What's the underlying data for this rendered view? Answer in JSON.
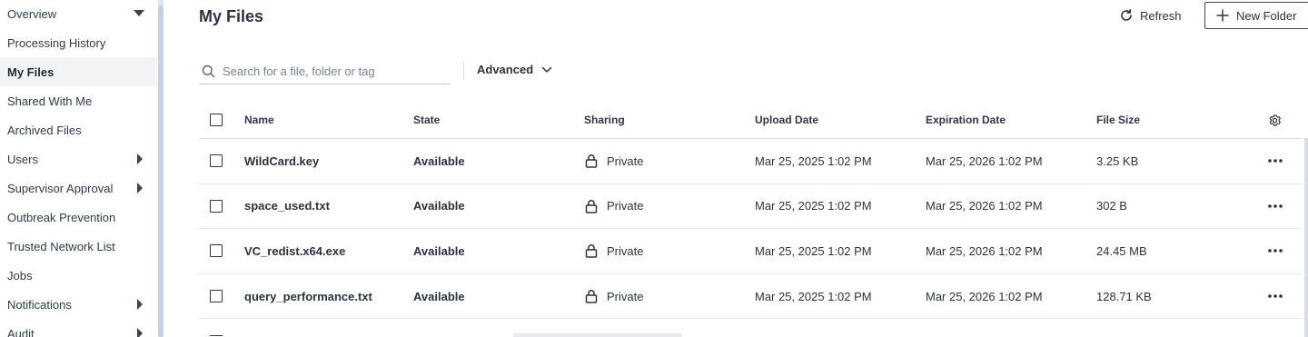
{
  "sidebar": {
    "items": [
      {
        "label": "Overview",
        "expander": "down"
      },
      {
        "label": "Processing History",
        "expander": ""
      },
      {
        "label": "My Files",
        "expander": "",
        "active": true
      },
      {
        "label": "Shared With Me",
        "expander": ""
      },
      {
        "label": "Archived Files",
        "expander": ""
      },
      {
        "label": "Users",
        "expander": "right"
      },
      {
        "label": "Supervisor Approval",
        "expander": "right"
      },
      {
        "label": "Outbreak Prevention",
        "expander": ""
      },
      {
        "label": "Trusted Network List",
        "expander": ""
      },
      {
        "label": "Jobs",
        "expander": ""
      },
      {
        "label": "Notifications",
        "expander": "right"
      },
      {
        "label": "Audit",
        "expander": "right"
      }
    ]
  },
  "header": {
    "title": "My Files",
    "refresh_label": "Refresh",
    "new_folder_label": "New Folder"
  },
  "search": {
    "placeholder": "Search for a file, folder or tag",
    "value": "",
    "advanced_label": "Advanced"
  },
  "table": {
    "columns": [
      "Name",
      "State",
      "Sharing",
      "Upload Date",
      "Expiration Date",
      "File Size"
    ],
    "rows": [
      {
        "name": "WildCard.key",
        "state": "Available",
        "sharing": "Private",
        "upload_date": "Mar 25, 2025 1:02 PM",
        "expiration_date": "Mar 25, 2026 1:02 PM",
        "size": "3.25 KB"
      },
      {
        "name": "space_used.txt",
        "state": "Available",
        "sharing": "Private",
        "upload_date": "Mar 25, 2025 1:02 PM",
        "expiration_date": "Mar 25, 2026 1:02 PM",
        "size": "302 B"
      },
      {
        "name": "VC_redist.x64.exe",
        "state": "Available",
        "sharing": "Private",
        "upload_date": "Mar 25, 2025 1:02 PM",
        "expiration_date": "Mar 25, 2026 1:02 PM",
        "size": "24.45 MB"
      },
      {
        "name": "query_performance.txt",
        "state": "Available",
        "sharing": "Private",
        "upload_date": "Mar 25, 2025 1:02 PM",
        "expiration_date": "Mar 25, 2026 1:02 PM",
        "size": "128.71 KB"
      }
    ]
  },
  "icons": {
    "search": "search-icon",
    "refresh": "refresh-icon",
    "plus": "plus-icon",
    "chevron": "chevron-down-icon",
    "settings": "gear-icon",
    "lock": "lock-icon",
    "more": "more-horizontal-icon"
  },
  "colors": {
    "text": "#2b3240",
    "active_bg": "#f1f3f5",
    "border": "#e3e6ea"
  }
}
